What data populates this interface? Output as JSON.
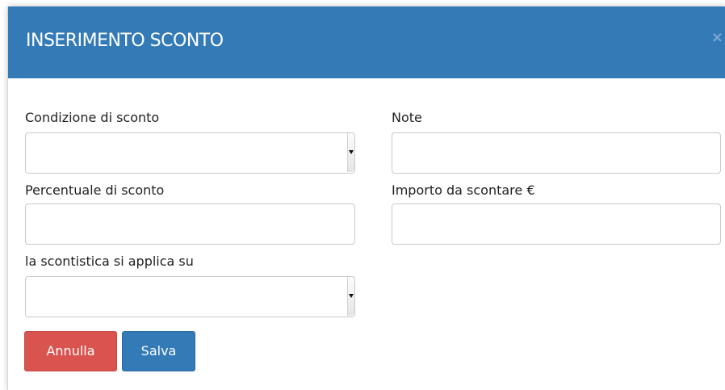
{
  "dialog": {
    "title": "INSERIMENTO SCONTO",
    "close_symbol": "×"
  },
  "form": {
    "condizione": {
      "label": "Condizione di sconto",
      "value": ""
    },
    "note": {
      "label": "Note",
      "value": ""
    },
    "percentuale": {
      "label": "Percentuale di sconto",
      "value": ""
    },
    "importo": {
      "label": "Importo da scontare €",
      "value": ""
    },
    "applica": {
      "label": "la scontistica si applica su",
      "value": ""
    }
  },
  "buttons": {
    "annulla": "Annulla",
    "salva": "Salva"
  },
  "colors": {
    "header": "#337ab7",
    "annulla": "#d9534f",
    "salva": "#337ab7"
  }
}
